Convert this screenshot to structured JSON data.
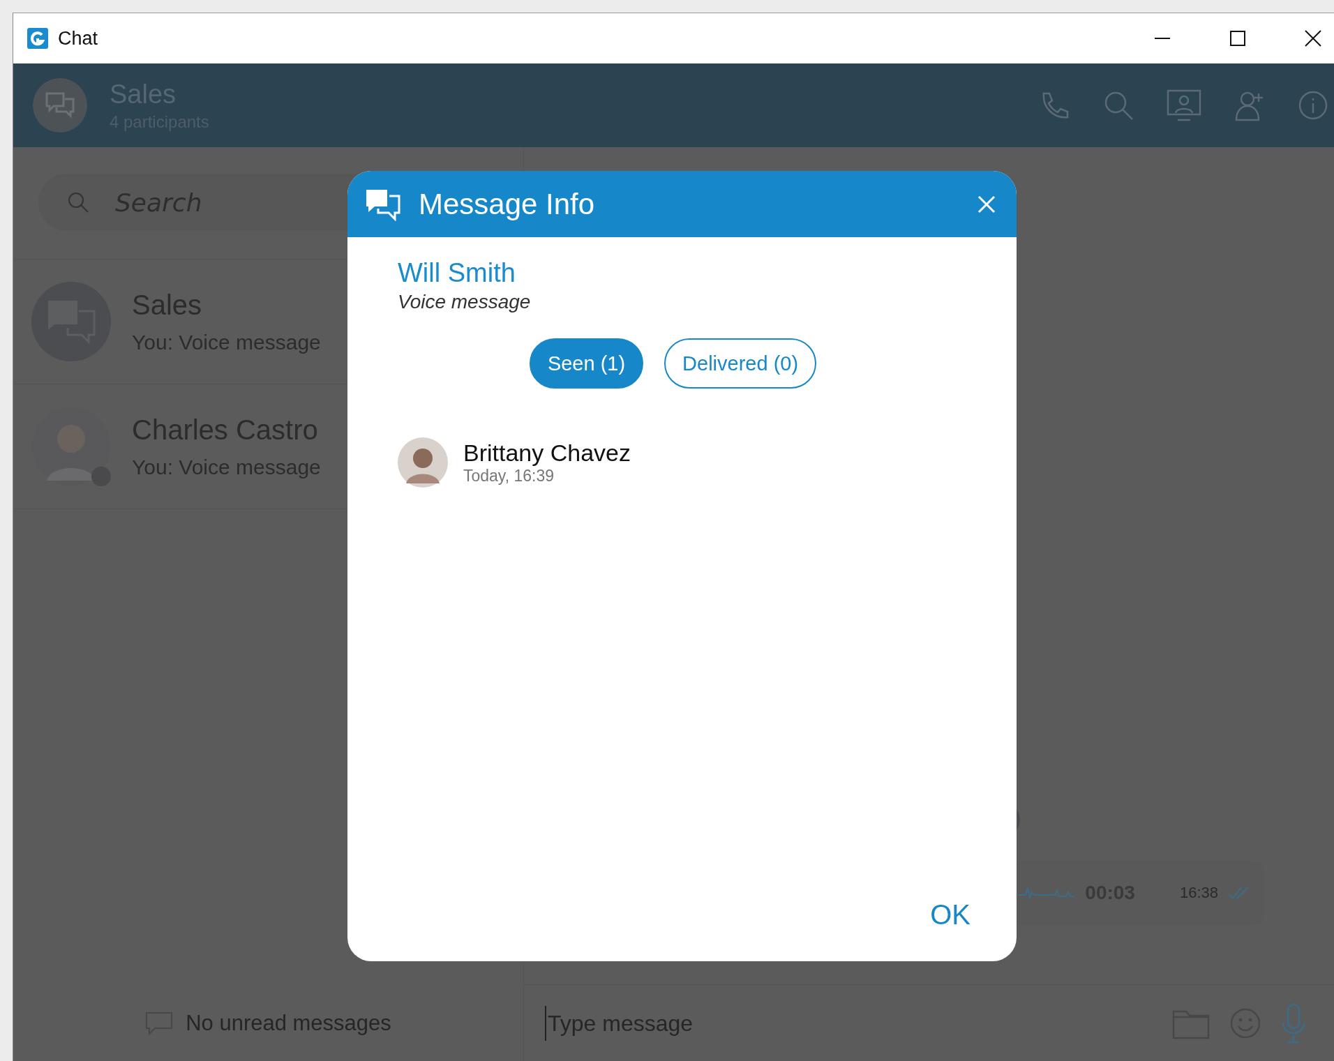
{
  "window": {
    "title": "Chat"
  },
  "chat_header": {
    "title": "Sales",
    "subtitle": "4 participants"
  },
  "sidebar": {
    "search": {
      "placeholder": "Search"
    },
    "conversations": [
      {
        "kind": "group",
        "name": "Sales",
        "preview": "You: Voice message"
      },
      {
        "kind": "person",
        "name": "Charles Castro",
        "preview": "You: Voice message"
      }
    ],
    "footer_note": "No unread messages"
  },
  "voice_message": {
    "duration": "00:03",
    "time": "16:38"
  },
  "composer": {
    "placeholder": "Type message"
  },
  "dialog": {
    "title": "Message Info",
    "sender": "Will Smith",
    "message": "Voice message",
    "tabs": [
      {
        "label": "Seen (1)",
        "selected": true
      },
      {
        "label": "Delivered (0)",
        "selected": false
      }
    ],
    "recipients": [
      {
        "name": "Brittany Chavez",
        "time": "Today, 16:39"
      }
    ],
    "ok": "OK"
  }
}
